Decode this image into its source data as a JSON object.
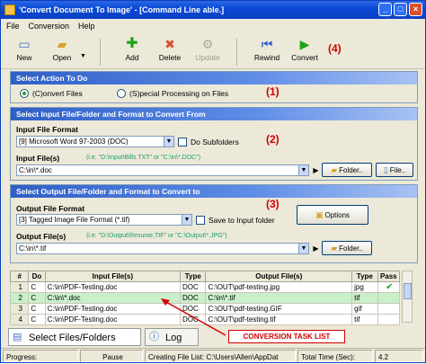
{
  "window": {
    "title": "'Convert Document To Image' - [Command Line able.]",
    "controls": [
      "_",
      "□",
      "×"
    ]
  },
  "menu": [
    "File",
    "Conversion",
    "Help"
  ],
  "toolbar": {
    "new": "New",
    "open": "Open",
    "add": "Add",
    "delete": "Delete",
    "update": "Update",
    "rewind": "Rewind",
    "convert": "Convert",
    "annotation": "(4)"
  },
  "section1": {
    "header": "Select Action To Do",
    "annotation": "(1)",
    "radio_convert": "(C)onvert Files",
    "radio_special": "(S)pecial Processing on Files",
    "selected": "convert"
  },
  "section2": {
    "header": "Select Input File/Folder and Format to Convert From",
    "annotation": "(2)",
    "format_label": "Input File Format",
    "format_value": "[9] Microsoft Word 97-2003 (DOC)",
    "subfolders_label": "Do Subfolders",
    "files_label": "Input File(s)",
    "files_hint": "(i.e. \"D:\\Input\\Bills.TXT\"  or \"C:\\in\\*.DOC\")",
    "files_value": "C:\\in\\*.doc",
    "folder_button": "Folder..",
    "file_button": "File.."
  },
  "section3": {
    "header": "Select Output File/Folder and Format to Convert to",
    "annotation": "(3)",
    "format_label": "Output File Format",
    "format_value": "[3] Tagged Image File Format (*.tif)",
    "save_to_input_label": "Save to Input folder",
    "options_button": "Options",
    "files_label": "Output File(s)",
    "files_hint": "(i.e. \"D:\\Output\\Resume.TIF\" or \"C:\\Output\\*.JPG\")",
    "files_value": "C:\\in\\*.tif",
    "folder_button": "Folder.."
  },
  "task_table": {
    "columns": [
      "#",
      "Do",
      "Input File(s)",
      "Type",
      "Output File(s)",
      "Type",
      "Pass"
    ],
    "rows": [
      {
        "n": "1",
        "do": "C",
        "input": "C:\\in\\PDF-Testing.doc",
        "type": "DOC",
        "output": "C:\\OUT\\pdf-testing.jpg",
        "otype": "jpg",
        "pass": "✔"
      },
      {
        "n": "2",
        "do": "C",
        "input": "C:\\in\\*.doc",
        "type": "DOC",
        "output": "C:\\in\\*.tif",
        "otype": "tif",
        "pass": ""
      },
      {
        "n": "3",
        "do": "C",
        "input": "C:\\in\\PDF-Testing.doc",
        "type": "DOC",
        "output": "C:\\OUT\\pdf-testing.GIF",
        "otype": "gif",
        "pass": ""
      },
      {
        "n": "4",
        "do": "C",
        "input": "C:\\in\\PDF-Testing.doc",
        "type": "DOC",
        "output": "C:\\OUT\\pdf-testing.tif",
        "otype": "tif",
        "pass": ""
      }
    ],
    "selected_row": 1
  },
  "bottom_tabs": [
    "Select Files/Folders",
    "Log"
  ],
  "callout": "CONVERSION TASK LIST",
  "status": {
    "progress": "Progress:",
    "pause": "Pause",
    "list_file": "Creating File List: C:\\Users\\Allen\\AppDat",
    "total_time": "Total Time (Sec):",
    "total_value": "4.2"
  },
  "colors": {
    "accent_red": "#d10000",
    "section_header": "#2e5fc6",
    "selected_row": "#c9f0c8",
    "hint_green": "#1a9e6a"
  }
}
